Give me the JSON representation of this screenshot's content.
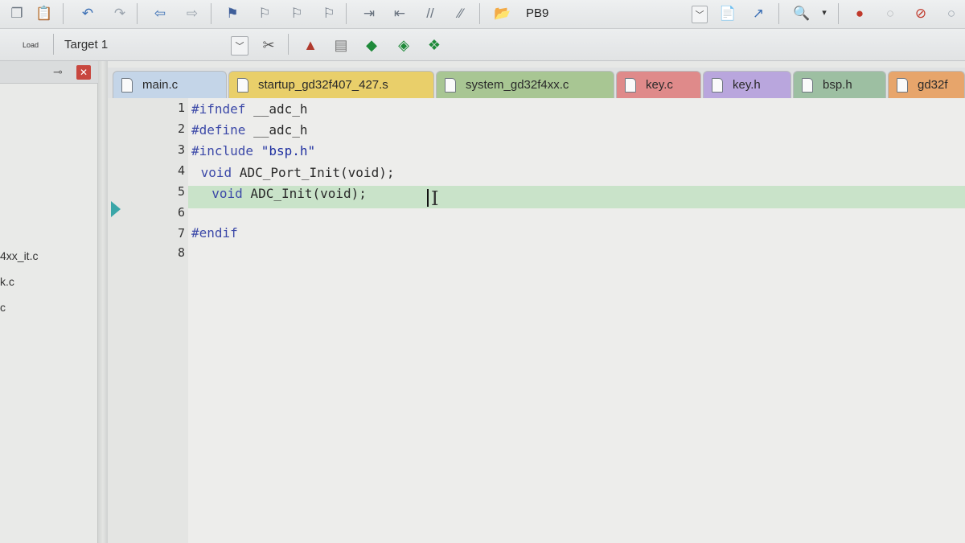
{
  "toolbar": {
    "project_name": "PB9",
    "target": "Target 1",
    "load_label": "Load"
  },
  "left_panel": {
    "files": [
      "4xx_it.c",
      "k.c",
      "c"
    ]
  },
  "tabs": [
    {
      "label": "main.c",
      "color": "#c4d5e8"
    },
    {
      "label": "startup_gd32f407_427.s",
      "color": "#e9cf6a"
    },
    {
      "label": "system_gd32f4xx.c",
      "color": "#a8c693"
    },
    {
      "label": "key.c",
      "color": "#df8a8a"
    },
    {
      "label": "key.h",
      "color": "#b9a6dd"
    },
    {
      "label": "bsp.h",
      "color": "#9dbfa2"
    },
    {
      "label": "gd32f",
      "color": "#e7a56b"
    }
  ],
  "editor": {
    "line_numbers": [
      "1",
      "2",
      "3",
      "4",
      "5",
      "6",
      "7",
      "8"
    ],
    "lines": [
      {
        "kw": "#ifndef",
        "rest": " __adc_h"
      },
      {
        "kw": "#define",
        "rest": " __adc_h"
      },
      {
        "kw": "#include",
        "str": " \"bsp.h\""
      },
      {
        "kw": " void",
        "rest": " ADC_Port_Init(void);"
      },
      {
        "kw": "  void",
        "rest": " ADC_Init(void);"
      },
      {
        "kw": "",
        "rest": ""
      },
      {
        "kw": "#endif",
        "rest": ""
      },
      {
        "kw": "",
        "rest": ""
      }
    ],
    "current_line": 5
  }
}
